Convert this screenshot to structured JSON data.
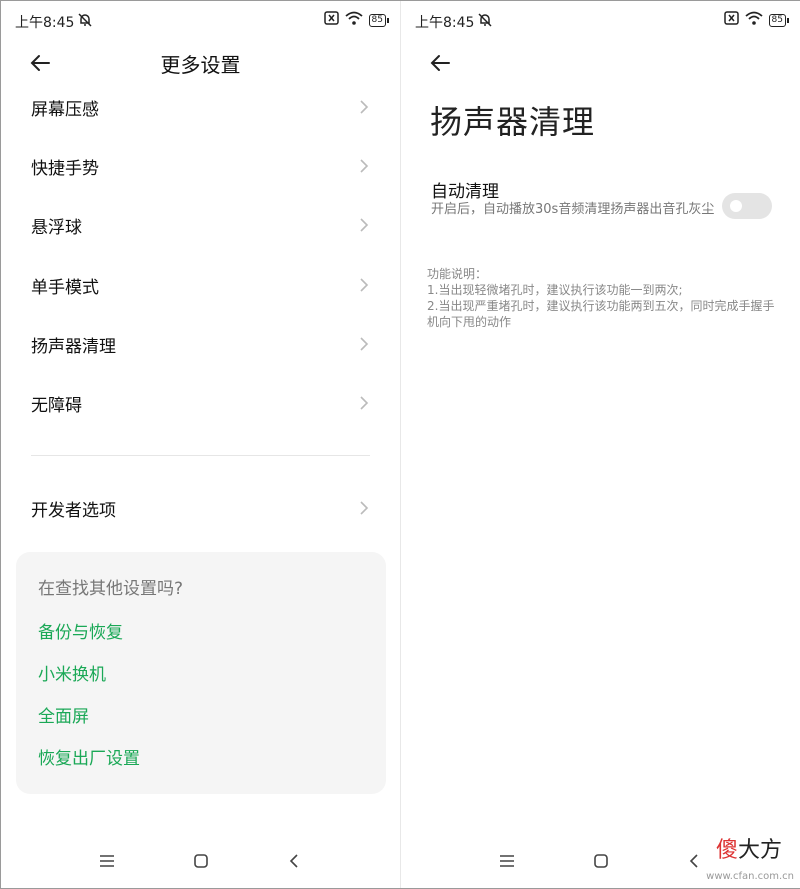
{
  "status": {
    "time": "上午8:45",
    "battery": "85"
  },
  "left": {
    "title": "更多设置",
    "items": [
      {
        "label": "屏幕压感"
      },
      {
        "label": "快捷手势"
      },
      {
        "label": "悬浮球"
      },
      {
        "label": "单手模式"
      },
      {
        "label": "扬声器清理"
      },
      {
        "label": "无障碍"
      }
    ],
    "developer": "开发者选项",
    "suggest": {
      "title": "在查找其他设置吗?",
      "links": [
        "备份与恢复",
        "小米换机",
        "全面屏",
        "恢复出厂设置"
      ]
    }
  },
  "right": {
    "title": "扬声器清理",
    "option_title": "自动清理",
    "option_desc": "开启后，自动播放30s音频清理扬声器出音孔灰尘",
    "toggle_on": false,
    "explain_title": "功能说明：",
    "explain_lines": [
      "1.当出现轻微堵孔时，建议执行该功能一到两次;",
      "2.当出现严重堵孔时，建议执行该功能两到五次，同时完成手握手机向下甩的动作"
    ]
  },
  "watermark": {
    "first": "傻",
    "rest": "大方",
    "url": "www.cfan.com.cn"
  },
  "colors": {
    "accent_green": "#1aa856",
    "toggle_off": "#e4e4e4",
    "card_bg": "#f5f5f5"
  },
  "icons": [
    "back-arrow-icon",
    "chevron-right-icon",
    "mute-bell-icon",
    "sim-x-icon",
    "wifi-icon",
    "battery-icon",
    "menu-lines-icon",
    "home-square-icon",
    "nav-back-icon"
  ]
}
